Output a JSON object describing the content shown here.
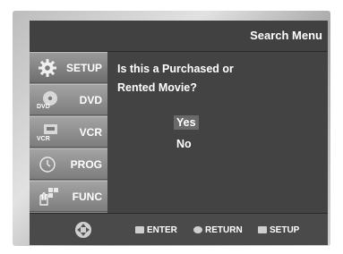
{
  "header": {
    "title": "Search Menu"
  },
  "sidebar": {
    "items": [
      {
        "label": "SETUP",
        "icon": "gear-icon"
      },
      {
        "label": "DVD",
        "icon": "dvd-disc-icon"
      },
      {
        "label": "VCR",
        "icon": "vcr-tape-icon"
      },
      {
        "label": "PROG",
        "icon": "clock-icon"
      },
      {
        "label": "FUNC",
        "icon": "hand-pointer-icon"
      }
    ]
  },
  "main": {
    "question_line1": "Is this a Purchased or",
    "question_line2": "Rented Movie?",
    "options": [
      {
        "label": "Yes",
        "selected": true
      },
      {
        "label": "No",
        "selected": false
      }
    ]
  },
  "footer": {
    "nav_icon": "dpad-icon",
    "enter_label": "ENTER",
    "return_label": "RETURN",
    "setup_label": "SETUP"
  }
}
